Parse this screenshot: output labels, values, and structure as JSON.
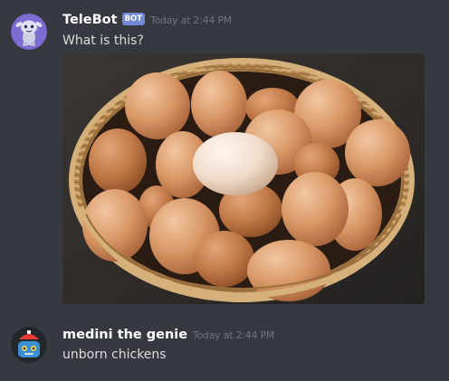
{
  "messages": [
    {
      "username": "TeleBot",
      "bot_tag": "BOT",
      "timestamp": "Today at 2:44 PM",
      "content": "What is this?",
      "avatar_icon": "alien-mascot-avatar",
      "attachment": {
        "icon": "egg-basket-photo"
      }
    },
    {
      "username": "medini the genie",
      "timestamp": "Today at 2:44 PM",
      "content": "unborn chickens",
      "avatar_icon": "genie-robot-avatar"
    }
  ],
  "colors": {
    "background": "#36393f",
    "username": "#ffffff",
    "text": "#dcddde",
    "timestamp": "#72767d",
    "bot_tag": "#7289da"
  }
}
